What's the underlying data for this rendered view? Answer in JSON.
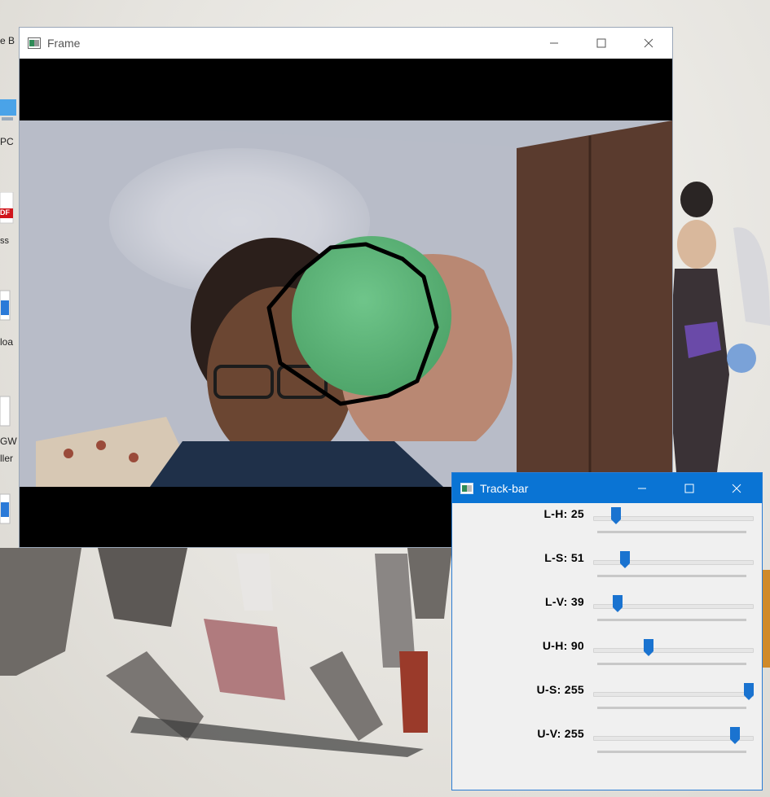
{
  "desktop": {
    "icon_labels": [
      "e B",
      "PC",
      "DF",
      "ss",
      "loa",
      "GW",
      "ller"
    ]
  },
  "frame_window": {
    "title": "Frame",
    "controls": [
      "minimize",
      "maximize",
      "close"
    ]
  },
  "trackbar_window": {
    "title": "Track-bar",
    "controls": [
      "minimize",
      "maximize",
      "close"
    ],
    "sliders": [
      {
        "label": "L-H: 25",
        "value": 25,
        "max": 179
      },
      {
        "label": "L-S: 51",
        "value": 51,
        "max": 255
      },
      {
        "label": "L-V: 39",
        "value": 39,
        "max": 255
      },
      {
        "label": "U-H: 90",
        "value": 90,
        "max": 255
      },
      {
        "label": "U-S: 255",
        "value": 255,
        "max": 255
      },
      {
        "label": "U-V: 255",
        "value": 255,
        "max": 280
      }
    ]
  },
  "colors": {
    "accent": "#0a74d4",
    "thumb": "#1a73d0",
    "ball": "#5fb77a",
    "contour": "#000000"
  }
}
